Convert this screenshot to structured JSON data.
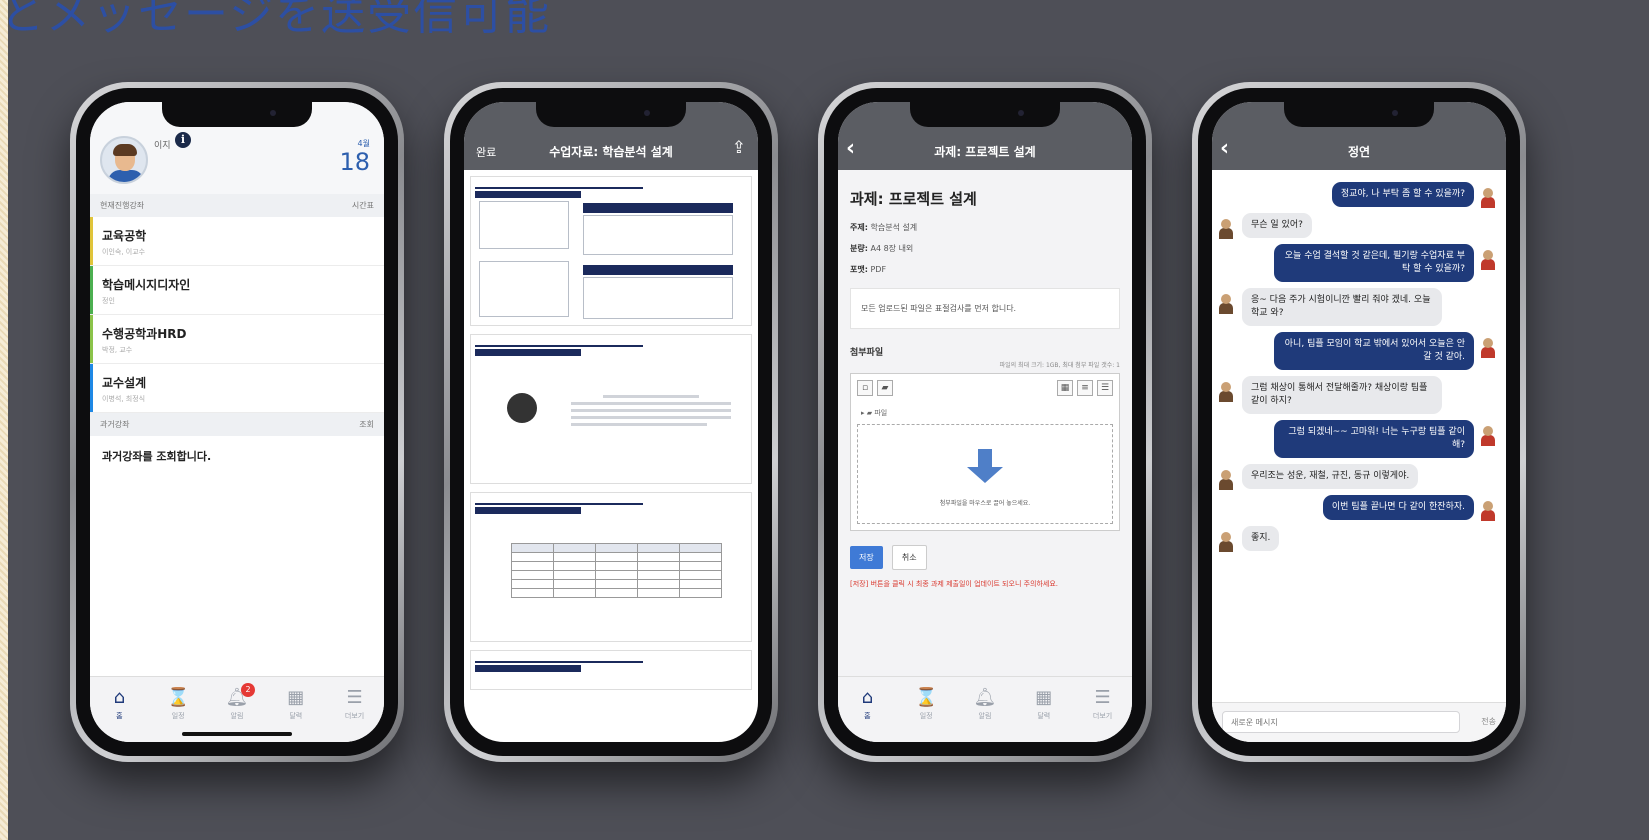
{
  "banner": {
    "title": "とメッセージを送受信可能"
  },
  "phone1": {
    "user": "이지",
    "date_month": "4월",
    "date_day": "18",
    "current_section": "현재진행강좌",
    "current_section_action": "시간표",
    "courses": [
      {
        "name": "교육공학",
        "sub": "이인숙, 이교수",
        "color": "#e0c43a"
      },
      {
        "name": "학습메시지디자인",
        "sub": "정인",
        "color": "#4caf50"
      },
      {
        "name": "수행공학과HRD",
        "sub": "박정, 교수",
        "color": "#8bc34a"
      },
      {
        "name": "교수설계",
        "sub": "이병석, 최정식",
        "color": "#1e88e5"
      }
    ],
    "past_section": "과거강좌",
    "past_section_action": "조회",
    "past_message": "과거강좌를 조회합니다.",
    "tabs": [
      {
        "icon": "home-icon",
        "glyph": "⌂",
        "label": "홈",
        "active": true
      },
      {
        "icon": "hourglass-icon",
        "glyph": "⌛",
        "label": "일정",
        "active": false
      },
      {
        "icon": "bell-icon",
        "glyph": "🔔︎",
        "label": "알림",
        "active": false,
        "badge": "2"
      },
      {
        "icon": "calendar-icon",
        "glyph": "▦",
        "label": "달력",
        "active": false
      },
      {
        "icon": "menu-icon",
        "glyph": "☰",
        "label": "더보기",
        "active": false
      }
    ]
  },
  "phone2": {
    "done": "완료",
    "title": "수업자료: 학습분석 설계",
    "share_icon": "share-icon"
  },
  "phone3": {
    "nav_title": "과제: 프로젝트 설계",
    "title": "과제: 프로젝트 설계",
    "topic_label": "주제:",
    "topic": "학습분석 설계",
    "length_label": "분량:",
    "length": "A4 8장 내외",
    "format_label": "포맷:",
    "format": "PDF",
    "note": "모든 업로드된 파일은 표절검사를 먼저 합니다.",
    "attach_label": "첨부파일",
    "attach_hint": "파일의 최대 크기: 1GB, 최대 첨부 파일 갯수: 1",
    "folder": "파일",
    "dropzone_text": "첨부파일을 마우스로 끌어 놓으세요.",
    "save": "저장",
    "cancel": "취소",
    "warning": "[저장] 버튼을 클릭 시 최종 과제 제출일이 업데이트 되오니 주의하세요.",
    "tabs": [
      {
        "icon": "home-icon",
        "glyph": "⌂",
        "label": "홈",
        "active": true
      },
      {
        "icon": "hourglass-icon",
        "glyph": "⌛",
        "label": "일정",
        "active": false
      },
      {
        "icon": "bell-icon",
        "glyph": "🔔︎",
        "label": "알림",
        "active": false
      },
      {
        "icon": "calendar-icon",
        "glyph": "▦",
        "label": "달력",
        "active": false
      },
      {
        "icon": "menu-icon",
        "glyph": "☰",
        "label": "더보기",
        "active": false
      }
    ]
  },
  "phone4": {
    "title": "정연",
    "messages": [
      {
        "dir": "out",
        "text": "정교야, 나 부탁 좀 할 수 있을까?"
      },
      {
        "dir": "in",
        "text": "무슨 일 있어?"
      },
      {
        "dir": "out",
        "text": "오늘 수업 결석할 것 같은데, 필기랑 수업자료 부탁 할 수 있을까?"
      },
      {
        "dir": "in",
        "text": "응~ 다음 주가 시험이니깐 빨리 줘야 겠네. 오늘 학교 와?"
      },
      {
        "dir": "out",
        "text": "아니, 팀플 모임이 학교 밖에서 있어서 오늘은 안 갈 것 같아."
      },
      {
        "dir": "in",
        "text": "그럼 채상이 통해서 전달해줄까? 채상이랑 팀플 같이 하지?"
      },
      {
        "dir": "out",
        "text": "그럼 되겠네~~ 고마워! 너는 누구랑 팀플 같이해?"
      },
      {
        "dir": "in",
        "text": "우리조는 성운, 재철, 규진, 동규 이렇게야."
      },
      {
        "dir": "out",
        "text": "이번 팀플 끝나면 다 같이 한잔하자."
      },
      {
        "dir": "in",
        "text": "좋지."
      }
    ],
    "input_placeholder": "새로운 메시지",
    "send": "전송"
  }
}
